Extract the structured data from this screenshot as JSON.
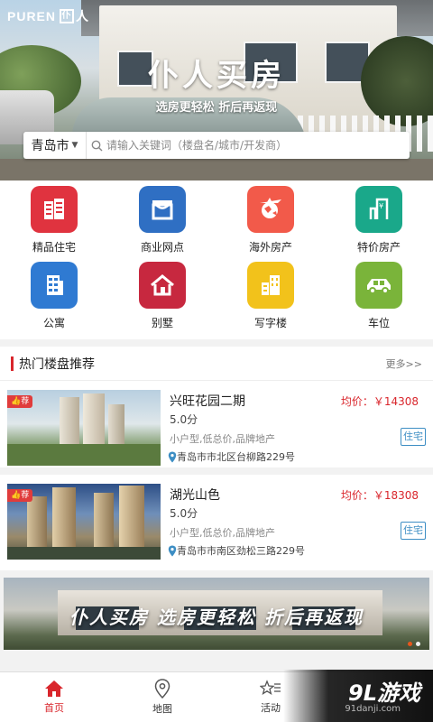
{
  "brand": {
    "logo_text": "PUREN",
    "logo_mark": "仆",
    "logo_tail": "人"
  },
  "hero": {
    "title": "仆人买房",
    "subtitle": "选房更轻松 折后再返现"
  },
  "search": {
    "city": "青岛市",
    "placeholder": "请输入关键词（楼盘名/城市/开发商）"
  },
  "categories": [
    {
      "label": "精品住宅",
      "icon": "buildings-icon",
      "color": "#e0333f"
    },
    {
      "label": "商业网点",
      "icon": "storefront-icon",
      "color": "#2f6fc3"
    },
    {
      "label": "海外房产",
      "icon": "globe-plane-icon",
      "color": "#f25a4a"
    },
    {
      "label": "特价房产",
      "icon": "price-door-icon",
      "color": "#1aa88a"
    },
    {
      "label": "公寓",
      "icon": "apartment-icon",
      "color": "#2f7ad2"
    },
    {
      "label": "别墅",
      "icon": "villa-icon",
      "color": "#c7283f"
    },
    {
      "label": "写字楼",
      "icon": "office-tower-icon",
      "color": "#f2c21b"
    },
    {
      "label": "车位",
      "icon": "car-icon",
      "color": "#7ab43a"
    }
  ],
  "hot": {
    "title": "热门楼盘推荐",
    "more": "更多>>",
    "items": [
      {
        "badge": "荐",
        "name": "兴旺花园二期",
        "price": "均价：￥14308",
        "score": "5.0分",
        "tags": "小户型,低总价,品牌地产",
        "address": "青岛市市北区台柳路229号",
        "type": "住宅"
      },
      {
        "badge": "荐",
        "name": "湖光山色",
        "price": "均价：￥18308",
        "score": "5.0分",
        "tags": "小户型,低总价,品牌地产",
        "address": "青岛市市南区劲松三路229号",
        "type": "住宅"
      }
    ]
  },
  "banner": {
    "text": "仆人买房  选房更轻松  折后再返现"
  },
  "tabs": [
    {
      "label": "首页",
      "icon": "home-icon",
      "active": true
    },
    {
      "label": "地图",
      "icon": "map-pin-icon",
      "active": false
    },
    {
      "label": "活动",
      "icon": "star-list-icon",
      "active": false
    },
    {
      "label": "",
      "icon": "",
      "active": false
    }
  ],
  "watermark": {
    "logo": "9L游戏",
    "site": "91danji.com"
  },
  "colors": {
    "accent": "#d9262c",
    "tag_blue": "#3d8ec4"
  }
}
